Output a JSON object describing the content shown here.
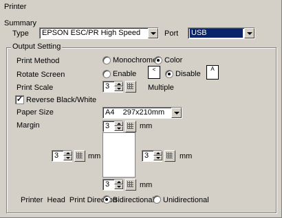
{
  "window": {
    "title": "Printer"
  },
  "summary": {
    "label": "Summary",
    "type_label": "Type",
    "type_value": "EPSON ESC/PR High Speed",
    "port_label": "Port",
    "port_value": "USB"
  },
  "output": {
    "title": "Output Setting",
    "print_method": {
      "label": "Print Method",
      "options": [
        "Monochrome",
        "Color"
      ],
      "selected": "Color"
    },
    "rotate_screen": {
      "label": "Rotate Screen",
      "options": [
        "Enable",
        "Disable"
      ],
      "selected": "Disable",
      "enable_icon": "<",
      "disable_icon": "A"
    },
    "print_scale": {
      "label": "Print Scale",
      "value": "3",
      "unit": "Multiple"
    },
    "reverse_bw": {
      "label": "Reverse Black/White",
      "checked": true,
      "check_mark": "✓"
    },
    "paper_size": {
      "label": "Paper Size",
      "value": "A4    297x210mm"
    },
    "margin": {
      "label": "Margin",
      "unit": "mm",
      "top": "3",
      "left": "3",
      "right": "3",
      "bottom": "3"
    },
    "print_direction": {
      "label": "Printer  Head  Print Direction",
      "options": [
        "Bidirectional",
        "Unidirectional"
      ],
      "selected": "Bidirectional"
    }
  },
  "colors": {
    "background": "#d4d0c8",
    "selection": "#0a246a"
  }
}
